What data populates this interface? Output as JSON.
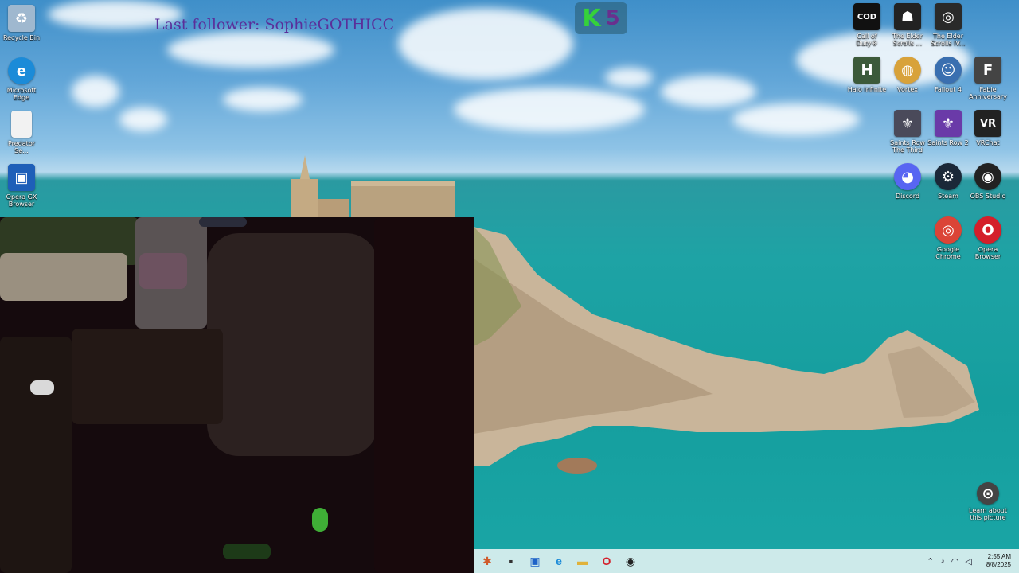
{
  "overlay": {
    "last_follower": "Last follower: SophieGOTHICC",
    "logo_k": "K",
    "logo_5": "5"
  },
  "desktop_icons_left": [
    {
      "label": "Recycle Bin",
      "icon": "recycle-bin-icon",
      "glyph": "♻",
      "color": "#9fb8cf"
    },
    {
      "label": "Microsoft Edge",
      "icon": "edge-icon",
      "glyph": "e",
      "color": "#1b8bd8"
    },
    {
      "label": "Predator Se...",
      "icon": "file-icon",
      "glyph": "",
      "color": "#f2f2f2"
    },
    {
      "label": "Opera GX Browser",
      "icon": "opera-gx-icon",
      "glyph": "▣",
      "color": "#1e5fb8"
    }
  ],
  "desktop_icons_right": [
    {
      "label": "Call of Duty®",
      "icon": "call-of-duty-icon",
      "glyph": "COD",
      "color": "#111111"
    },
    {
      "label": "The Elder Scrolls ...",
      "icon": "elder-scrolls-icon",
      "glyph": "☗",
      "color": "#222222"
    },
    {
      "label": "The Elder Scrolls IV...",
      "icon": "oblivion-icon",
      "glyph": "◎",
      "color": "#2a2a2a"
    },
    {
      "label": "Halo Infinite",
      "icon": "halo-infinite-icon",
      "glyph": "H",
      "color": "#3c5a3a"
    },
    {
      "label": "Vortex",
      "icon": "vortex-icon",
      "glyph": "◍",
      "color": "#d8a23a"
    },
    {
      "label": "Fallout 4",
      "icon": "fallout-4-icon",
      "glyph": "☺",
      "color": "#3a6fb0"
    },
    {
      "label": "Fable Anniversary",
      "icon": "fable-icon",
      "glyph": "F",
      "color": "#444444"
    },
    {
      "label": "Saints Row The Third",
      "icon": "saints-row-third-icon",
      "glyph": "⚜",
      "color": "#4a4a5a"
    },
    {
      "label": "Saints Row 2",
      "icon": "saints-row-2-icon",
      "glyph": "⚜",
      "color": "#6a3aa8"
    },
    {
      "label": "VRChat",
      "icon": "vrchat-icon",
      "glyph": "VR",
      "color": "#222222"
    },
    {
      "label": "Discord",
      "icon": "discord-icon",
      "glyph": "◕",
      "color": "#5865f2"
    },
    {
      "label": "Steam",
      "icon": "steam-icon",
      "glyph": "⚙",
      "color": "#1b2838"
    },
    {
      "label": "OBS Studio",
      "icon": "obs-icon",
      "glyph": "◉",
      "color": "#222222"
    },
    {
      "label": "Google Chrome",
      "icon": "chrome-icon",
      "glyph": "◎",
      "color": "#db4437"
    },
    {
      "label": "Opera Browser",
      "icon": "opera-icon",
      "glyph": "O",
      "color": "#d41f2a"
    },
    {
      "label": "Learn about this picture",
      "icon": "camera-icon",
      "glyph": "⊙",
      "color": "#444444"
    }
  ],
  "taskbar": {
    "items": [
      {
        "name": "copilot-icon",
        "glyph": "✱"
      },
      {
        "name": "task-view-icon",
        "glyph": "▪"
      },
      {
        "name": "app-window-icon",
        "glyph": "▣"
      },
      {
        "name": "edge-taskbar-icon",
        "glyph": "e"
      },
      {
        "name": "file-explorer-icon",
        "glyph": "▬"
      },
      {
        "name": "opera-taskbar-icon",
        "glyph": "O"
      },
      {
        "name": "obs-taskbar-icon",
        "glyph": "◉"
      }
    ],
    "time": "2:55 AM",
    "date": "8/8/2025"
  }
}
